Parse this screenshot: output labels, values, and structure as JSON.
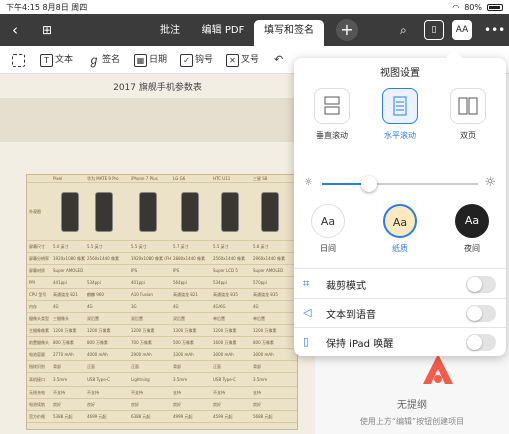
{
  "status": {
    "time": "下午4:15",
    "date": "8月8日 周四",
    "battery": "80%"
  },
  "nav": {
    "tabs": [
      {
        "label": "批注",
        "active": false
      },
      {
        "label": "编辑 PDF",
        "active": false
      },
      {
        "label": "填写和签名",
        "active": true
      }
    ],
    "add_label": "+",
    "view_button_label": "AA"
  },
  "toolbar": {
    "text": "文本",
    "sign": "签名",
    "date": "日期",
    "check": "钩号",
    "cross": "叉号"
  },
  "document": {
    "title": "2017 旗舰手机参数表",
    "table_rows": [
      [
        "",
        "Pixel",
        "华为 MATE 9 Pro",
        "iPhone 7 Plus",
        "LG G6",
        "HTC U11",
        "三星 S8"
      ],
      [
        "外观图",
        "",
        "",
        "",
        "",
        "",
        ""
      ],
      [
        "屏幕尺寸",
        "5.0 英寸",
        "5.5 英寸",
        "5.5 英寸",
        "5.7 英寸",
        "5.5 英寸",
        "5.8 英寸"
      ],
      [
        "屏幕分辨率",
        "1920x1080 像素",
        "2560x1440 像素",
        "1920x1080 像素 (FHD)",
        "2880x1440 像素",
        "2560x1440 像素",
        "2960x1440 像素"
      ],
      [
        "屏幕材质",
        "Super AMOLED",
        "",
        "IPS",
        "IPS",
        "Super LCD 5",
        "Super AMOLED"
      ],
      [
        "PPI",
        "441ppi",
        "534ppi",
        "401ppi",
        "564ppi",
        "534ppi",
        "570ppi"
      ],
      [
        "CPU 型号",
        "高通骁龙 821",
        "麒麟 960",
        "A10 Fusion",
        "高通骁龙 821",
        "高通骁龙 835",
        "高通骁龙 835"
      ],
      [
        "内存",
        "4G",
        "4G",
        "3G",
        "4G",
        "4G/6G",
        "4G"
      ],
      [
        "摄像头类型",
        "三摄像头",
        "双后置",
        "双后置",
        "双后置",
        "单后置",
        "单后置"
      ],
      [
        "主摄像像素",
        "1200 万像素",
        "1200 万像素",
        "1200 万像素",
        "1300 万像素",
        "1200 万像素",
        "1200 万像素"
      ],
      [
        "前置摄像头",
        "800 万像素",
        "800 万像素",
        "700 万像素",
        "500 万像素",
        "1600 万像素",
        "800 万像素"
      ],
      [
        "电池容量",
        "2770 mAh",
        "4000 mAh",
        "2900 mAh",
        "3300 mAh",
        "3000 mAh",
        "3000 mAh"
      ],
      [
        "指纹识别",
        "背部",
        "正面",
        "正面",
        "背部",
        "正面",
        "背部"
      ],
      [
        "耳机接口",
        "3.5mm",
        "USB Type-C",
        "Lightning",
        "3.5mm",
        "USB Type-C",
        "3.5mm"
      ],
      [
        "无线充电",
        "不支持",
        "不支持",
        "不支持",
        "支持",
        "不支持",
        "支持"
      ],
      [
        "电池续航",
        "良好",
        "良好",
        "良好",
        "良好",
        "良好",
        "良好"
      ],
      [
        "官方价格",
        "5388 元起",
        "4699 元起",
        "6388 元起",
        "4999 元起",
        "4599 元起",
        "5688 元起"
      ]
    ]
  },
  "sidepane": {
    "empty_title": "无提纲",
    "empty_hint": "使用上方“编辑”按钮创建项目"
  },
  "popover": {
    "title": "视图设置",
    "modes": [
      {
        "label": "垂直滚动",
        "selected": false,
        "icon": "vertical-scroll-icon"
      },
      {
        "label": "水平滚动",
        "selected": true,
        "icon": "horizontal-scroll-icon"
      },
      {
        "label": "双页",
        "selected": false,
        "icon": "two-page-icon"
      }
    ],
    "brightness": 0.3,
    "themes": [
      {
        "glyph": "Aa",
        "label": "日间",
        "selected": false,
        "bg": "#ffffff",
        "fg": "#333333"
      },
      {
        "glyph": "Aa",
        "label": "纸质",
        "selected": true,
        "bg": "#fbe9bf",
        "fg": "#333333"
      },
      {
        "glyph": "Aa",
        "label": "夜间",
        "selected": false,
        "bg": "#222222",
        "fg": "#ffffff"
      }
    ],
    "options": [
      {
        "label": "裁剪模式",
        "icon": "crop-icon",
        "on": false
      },
      {
        "label": "文本到语音",
        "icon": "speaker-icon",
        "on": false
      },
      {
        "label": "保持 iPad 唤醒",
        "icon": "ipad-icon",
        "on": false
      }
    ]
  },
  "colors": {
    "accent": "#2a7de1",
    "navbar": "#3b3b3b",
    "paper": "#fbe9bf"
  }
}
